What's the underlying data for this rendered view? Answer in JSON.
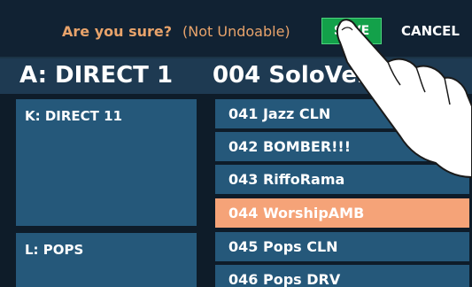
{
  "confirm": {
    "question": "Are you sure?",
    "note": "(Not Undoable)",
    "save_label": "SAVE",
    "cancel_label": "CANCEL"
  },
  "header": {
    "bank": "A: DIRECT 1",
    "patch": "004 SoloVelv"
  },
  "banks": [
    {
      "label": "K: DIRECT 11"
    },
    {
      "label": "L: POPS"
    }
  ],
  "patches": [
    {
      "label": "041 Jazz CLN",
      "selected": false
    },
    {
      "label": "042 BOMBER!!!",
      "selected": false
    },
    {
      "label": "043 RiffoRama",
      "selected": false
    },
    {
      "label": "044 WorshipAMB",
      "selected": true
    },
    {
      "label": "045 Pops CLN",
      "selected": false
    },
    {
      "label": "046 Pops DRV",
      "selected": false
    }
  ],
  "colors": {
    "accent_save": "#13a14a",
    "selected_patch": "#f5a378",
    "list_item": "#25587a",
    "prompt_text": "#e8a36b"
  },
  "icons": {
    "pointer": "pointing-hand-icon"
  }
}
